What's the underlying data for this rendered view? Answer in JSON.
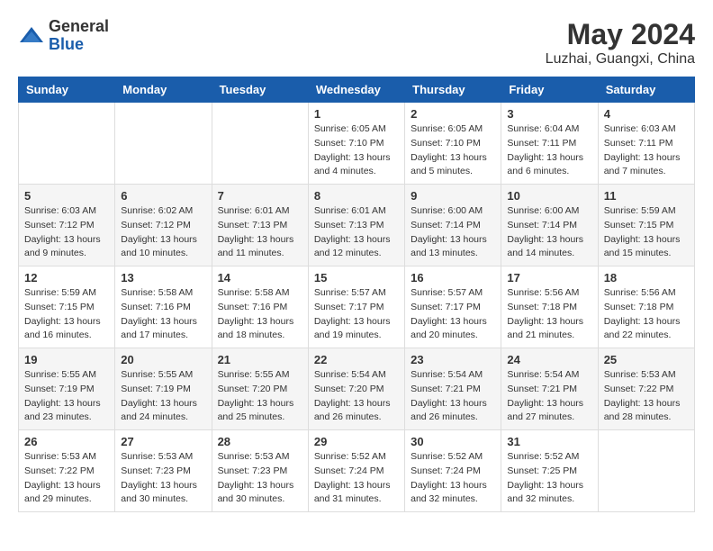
{
  "header": {
    "logo_general": "General",
    "logo_blue": "Blue",
    "month_year": "May 2024",
    "location": "Luzhai, Guangxi, China"
  },
  "days_of_week": [
    "Sunday",
    "Monday",
    "Tuesday",
    "Wednesday",
    "Thursday",
    "Friday",
    "Saturday"
  ],
  "weeks": [
    [
      {
        "day": "",
        "info": ""
      },
      {
        "day": "",
        "info": ""
      },
      {
        "day": "",
        "info": ""
      },
      {
        "day": "1",
        "info": "Sunrise: 6:05 AM\nSunset: 7:10 PM\nDaylight: 13 hours\nand 4 minutes."
      },
      {
        "day": "2",
        "info": "Sunrise: 6:05 AM\nSunset: 7:10 PM\nDaylight: 13 hours\nand 5 minutes."
      },
      {
        "day": "3",
        "info": "Sunrise: 6:04 AM\nSunset: 7:11 PM\nDaylight: 13 hours\nand 6 minutes."
      },
      {
        "day": "4",
        "info": "Sunrise: 6:03 AM\nSunset: 7:11 PM\nDaylight: 13 hours\nand 7 minutes."
      }
    ],
    [
      {
        "day": "5",
        "info": "Sunrise: 6:03 AM\nSunset: 7:12 PM\nDaylight: 13 hours\nand 9 minutes."
      },
      {
        "day": "6",
        "info": "Sunrise: 6:02 AM\nSunset: 7:12 PM\nDaylight: 13 hours\nand 10 minutes."
      },
      {
        "day": "7",
        "info": "Sunrise: 6:01 AM\nSunset: 7:13 PM\nDaylight: 13 hours\nand 11 minutes."
      },
      {
        "day": "8",
        "info": "Sunrise: 6:01 AM\nSunset: 7:13 PM\nDaylight: 13 hours\nand 12 minutes."
      },
      {
        "day": "9",
        "info": "Sunrise: 6:00 AM\nSunset: 7:14 PM\nDaylight: 13 hours\nand 13 minutes."
      },
      {
        "day": "10",
        "info": "Sunrise: 6:00 AM\nSunset: 7:14 PM\nDaylight: 13 hours\nand 14 minutes."
      },
      {
        "day": "11",
        "info": "Sunrise: 5:59 AM\nSunset: 7:15 PM\nDaylight: 13 hours\nand 15 minutes."
      }
    ],
    [
      {
        "day": "12",
        "info": "Sunrise: 5:59 AM\nSunset: 7:15 PM\nDaylight: 13 hours\nand 16 minutes."
      },
      {
        "day": "13",
        "info": "Sunrise: 5:58 AM\nSunset: 7:16 PM\nDaylight: 13 hours\nand 17 minutes."
      },
      {
        "day": "14",
        "info": "Sunrise: 5:58 AM\nSunset: 7:16 PM\nDaylight: 13 hours\nand 18 minutes."
      },
      {
        "day": "15",
        "info": "Sunrise: 5:57 AM\nSunset: 7:17 PM\nDaylight: 13 hours\nand 19 minutes."
      },
      {
        "day": "16",
        "info": "Sunrise: 5:57 AM\nSunset: 7:17 PM\nDaylight: 13 hours\nand 20 minutes."
      },
      {
        "day": "17",
        "info": "Sunrise: 5:56 AM\nSunset: 7:18 PM\nDaylight: 13 hours\nand 21 minutes."
      },
      {
        "day": "18",
        "info": "Sunrise: 5:56 AM\nSunset: 7:18 PM\nDaylight: 13 hours\nand 22 minutes."
      }
    ],
    [
      {
        "day": "19",
        "info": "Sunrise: 5:55 AM\nSunset: 7:19 PM\nDaylight: 13 hours\nand 23 minutes."
      },
      {
        "day": "20",
        "info": "Sunrise: 5:55 AM\nSunset: 7:19 PM\nDaylight: 13 hours\nand 24 minutes."
      },
      {
        "day": "21",
        "info": "Sunrise: 5:55 AM\nSunset: 7:20 PM\nDaylight: 13 hours\nand 25 minutes."
      },
      {
        "day": "22",
        "info": "Sunrise: 5:54 AM\nSunset: 7:20 PM\nDaylight: 13 hours\nand 26 minutes."
      },
      {
        "day": "23",
        "info": "Sunrise: 5:54 AM\nSunset: 7:21 PM\nDaylight: 13 hours\nand 26 minutes."
      },
      {
        "day": "24",
        "info": "Sunrise: 5:54 AM\nSunset: 7:21 PM\nDaylight: 13 hours\nand 27 minutes."
      },
      {
        "day": "25",
        "info": "Sunrise: 5:53 AM\nSunset: 7:22 PM\nDaylight: 13 hours\nand 28 minutes."
      }
    ],
    [
      {
        "day": "26",
        "info": "Sunrise: 5:53 AM\nSunset: 7:22 PM\nDaylight: 13 hours\nand 29 minutes."
      },
      {
        "day": "27",
        "info": "Sunrise: 5:53 AM\nSunset: 7:23 PM\nDaylight: 13 hours\nand 30 minutes."
      },
      {
        "day": "28",
        "info": "Sunrise: 5:53 AM\nSunset: 7:23 PM\nDaylight: 13 hours\nand 30 minutes."
      },
      {
        "day": "29",
        "info": "Sunrise: 5:52 AM\nSunset: 7:24 PM\nDaylight: 13 hours\nand 31 minutes."
      },
      {
        "day": "30",
        "info": "Sunrise: 5:52 AM\nSunset: 7:24 PM\nDaylight: 13 hours\nand 32 minutes."
      },
      {
        "day": "31",
        "info": "Sunrise: 5:52 AM\nSunset: 7:25 PM\nDaylight: 13 hours\nand 32 minutes."
      },
      {
        "day": "",
        "info": ""
      }
    ]
  ]
}
